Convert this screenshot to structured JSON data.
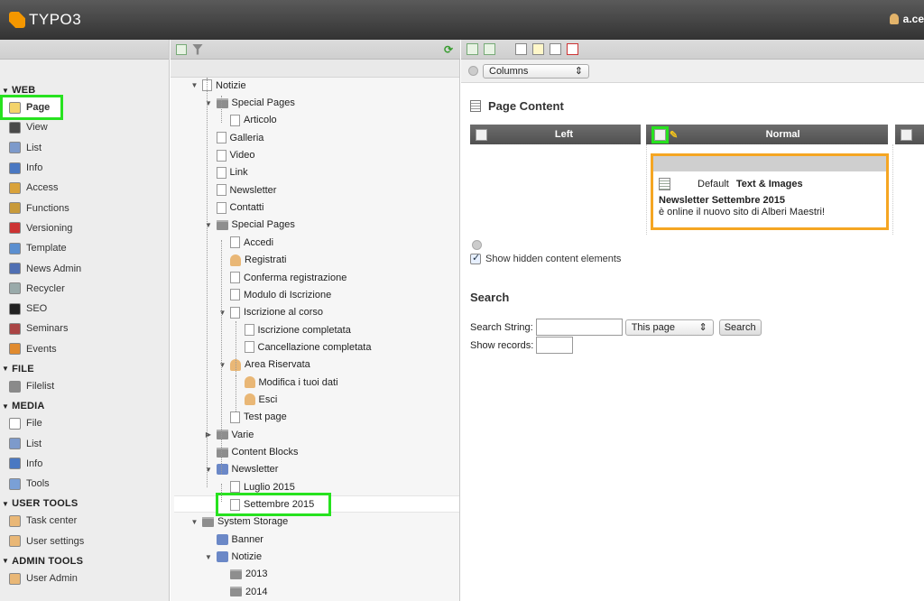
{
  "app": {
    "logo_text": "TYPO3",
    "user": "a.ce"
  },
  "modules": {
    "groups": [
      {
        "title": "WEB",
        "items": [
          "Page",
          "View",
          "List",
          "Info",
          "Access",
          "Functions",
          "Versioning",
          "Template",
          "News Admin",
          "Recycler",
          "SEO",
          "Seminars",
          "Events"
        ]
      },
      {
        "title": "FILE",
        "items": [
          "Filelist"
        ]
      },
      {
        "title": "MEDIA",
        "items": [
          "File",
          "List",
          "Info",
          "Tools"
        ]
      },
      {
        "title": "USER TOOLS",
        "items": [
          "Task center",
          "User settings"
        ]
      },
      {
        "title": "ADMIN TOOLS",
        "items": [
          "User Admin"
        ]
      }
    ],
    "active": "Page"
  },
  "tree": {
    "nodes": [
      {
        "label": "Notizie",
        "type": "page"
      },
      {
        "label": "Special Pages",
        "type": "folder"
      },
      {
        "label": "Articolo",
        "type": "page"
      },
      {
        "label": "Galleria",
        "type": "page"
      },
      {
        "label": "Video",
        "type": "page"
      },
      {
        "label": "Link",
        "type": "page"
      },
      {
        "label": "Newsletter",
        "type": "page"
      },
      {
        "label": "Contatti",
        "type": "page"
      },
      {
        "label": "Special Pages",
        "type": "folder"
      },
      {
        "label": "Accedi",
        "type": "page"
      },
      {
        "label": "Registrati",
        "type": "user"
      },
      {
        "label": "Conferma registrazione",
        "type": "page"
      },
      {
        "label": "Modulo di Iscrizione",
        "type": "page"
      },
      {
        "label": "Iscrizione al corso",
        "type": "page"
      },
      {
        "label": "Iscrizione completata",
        "type": "page"
      },
      {
        "label": "Cancellazione completata",
        "type": "page"
      },
      {
        "label": "Area Riservata",
        "type": "user"
      },
      {
        "label": "Modifica i tuoi dati",
        "type": "user"
      },
      {
        "label": "Esci",
        "type": "user"
      },
      {
        "label": "Test page",
        "type": "page"
      },
      {
        "label": "Varie",
        "type": "folder"
      },
      {
        "label": "Content Blocks",
        "type": "folder"
      },
      {
        "label": "Newsletter",
        "type": "special"
      },
      {
        "label": "Luglio 2015",
        "type": "page"
      },
      {
        "label": "Settembre 2015",
        "type": "page"
      },
      {
        "label": "System Storage",
        "type": "folder"
      },
      {
        "label": "Banner",
        "type": "special"
      },
      {
        "label": "Notizie",
        "type": "special"
      },
      {
        "label": "2013",
        "type": "folder"
      },
      {
        "label": "2014",
        "type": "folder"
      }
    ],
    "selected": "Settembre 2015"
  },
  "content": {
    "view_select": "Columns",
    "title": "Page Content",
    "columns": [
      "Left",
      "Normal"
    ],
    "element": {
      "type_prefix": "Default",
      "type": "Text & Images",
      "header": "Newsletter Settembre 2015",
      "bodytext": "è online il nuovo sito di Alberi Maestri!"
    },
    "show_hidden_label": "Show hidden content elements",
    "search": {
      "title": "Search",
      "string_label": "Search String:",
      "scope": "This page",
      "button": "Search",
      "records_label": "Show records:"
    }
  },
  "colors": {
    "highlight_green": "#27e21f",
    "highlight_orange": "#f5a623",
    "brand_orange": "#f49700"
  }
}
